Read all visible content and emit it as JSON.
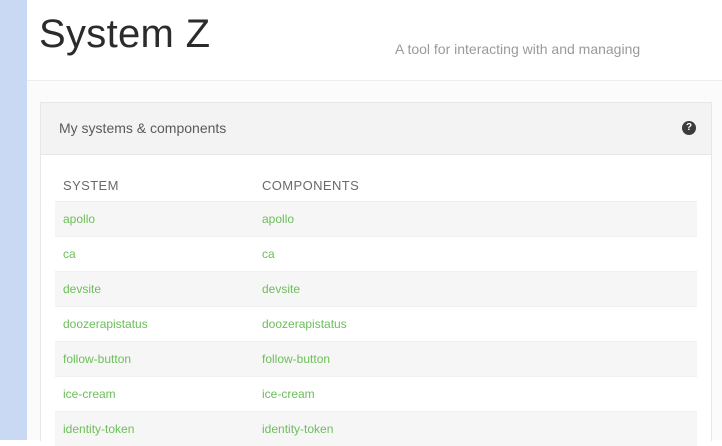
{
  "header": {
    "title": "System Z",
    "tagline": "A tool for interacting with and managing"
  },
  "panel": {
    "title": "My systems & components",
    "help_icon": "question-circle-icon",
    "columns": {
      "system": "SYSTEM",
      "components": "COMPONENTS"
    },
    "rows": [
      {
        "system": "apollo",
        "component": "apollo"
      },
      {
        "system": "ca",
        "component": "ca"
      },
      {
        "system": "devsite",
        "component": "devsite"
      },
      {
        "system": "doozerapistatus",
        "component": "doozerapistatus"
      },
      {
        "system": "follow-button",
        "component": "follow-button"
      },
      {
        "system": "ice-cream",
        "component": "ice-cream"
      },
      {
        "system": "identity-token",
        "component": "identity-token"
      }
    ]
  },
  "colors": {
    "link": "#6bbf59",
    "left_rail": "#c9d8f3",
    "panel_header": "#f3f3f3"
  }
}
